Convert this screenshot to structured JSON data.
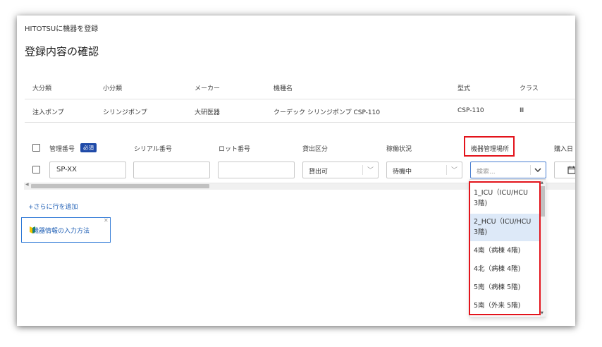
{
  "breadcrumb": "HITOTSUに機器を登録",
  "page_title": "登録内容の確認",
  "info_table": {
    "headers": [
      "大分類",
      "小分類",
      "メーカー",
      "機種名",
      "型式",
      "クラス"
    ],
    "values": [
      "注入ポンプ",
      "シリンジポンプ",
      "大研医器",
      "クーデック シリンジポンプ CSP-110",
      "CSP-110",
      "Ⅲ"
    ]
  },
  "form": {
    "headers": [
      "管理番号",
      "シリアル番号",
      "ロット番号",
      "貸出区分",
      "稼働状況",
      "機器管理場所",
      "購入日"
    ],
    "required_badge": "必須",
    "management_number_value": "SP-XX",
    "lending_value": "貸出可",
    "status_value": "待機中",
    "location_placeholder": "検索...",
    "location_options": [
      [
        "1_ICU（ICU/HCU",
        "3階)"
      ],
      [
        "2_HCU（ICU/HCU",
        "3階)"
      ],
      [
        "4南（病棟 4階)"
      ],
      [
        "4北（病棟 4階)"
      ],
      [
        "5南（病棟 5階)"
      ],
      [
        "5南（外来 5階)"
      ]
    ],
    "selected_option_index": 1
  },
  "add_row_link": "+さらに行を追加",
  "help_tip": "機器情報の入力方法",
  "colors": {
    "highlight": "#e3131b",
    "accent": "#1f4aa8",
    "link": "#1f5fb5",
    "selected_option_bg": "#dde9f8"
  },
  "icons": [
    "checkbox-icon",
    "chevron-down-icon",
    "calendar-icon",
    "beginner-mark-icon",
    "close-icon"
  ]
}
